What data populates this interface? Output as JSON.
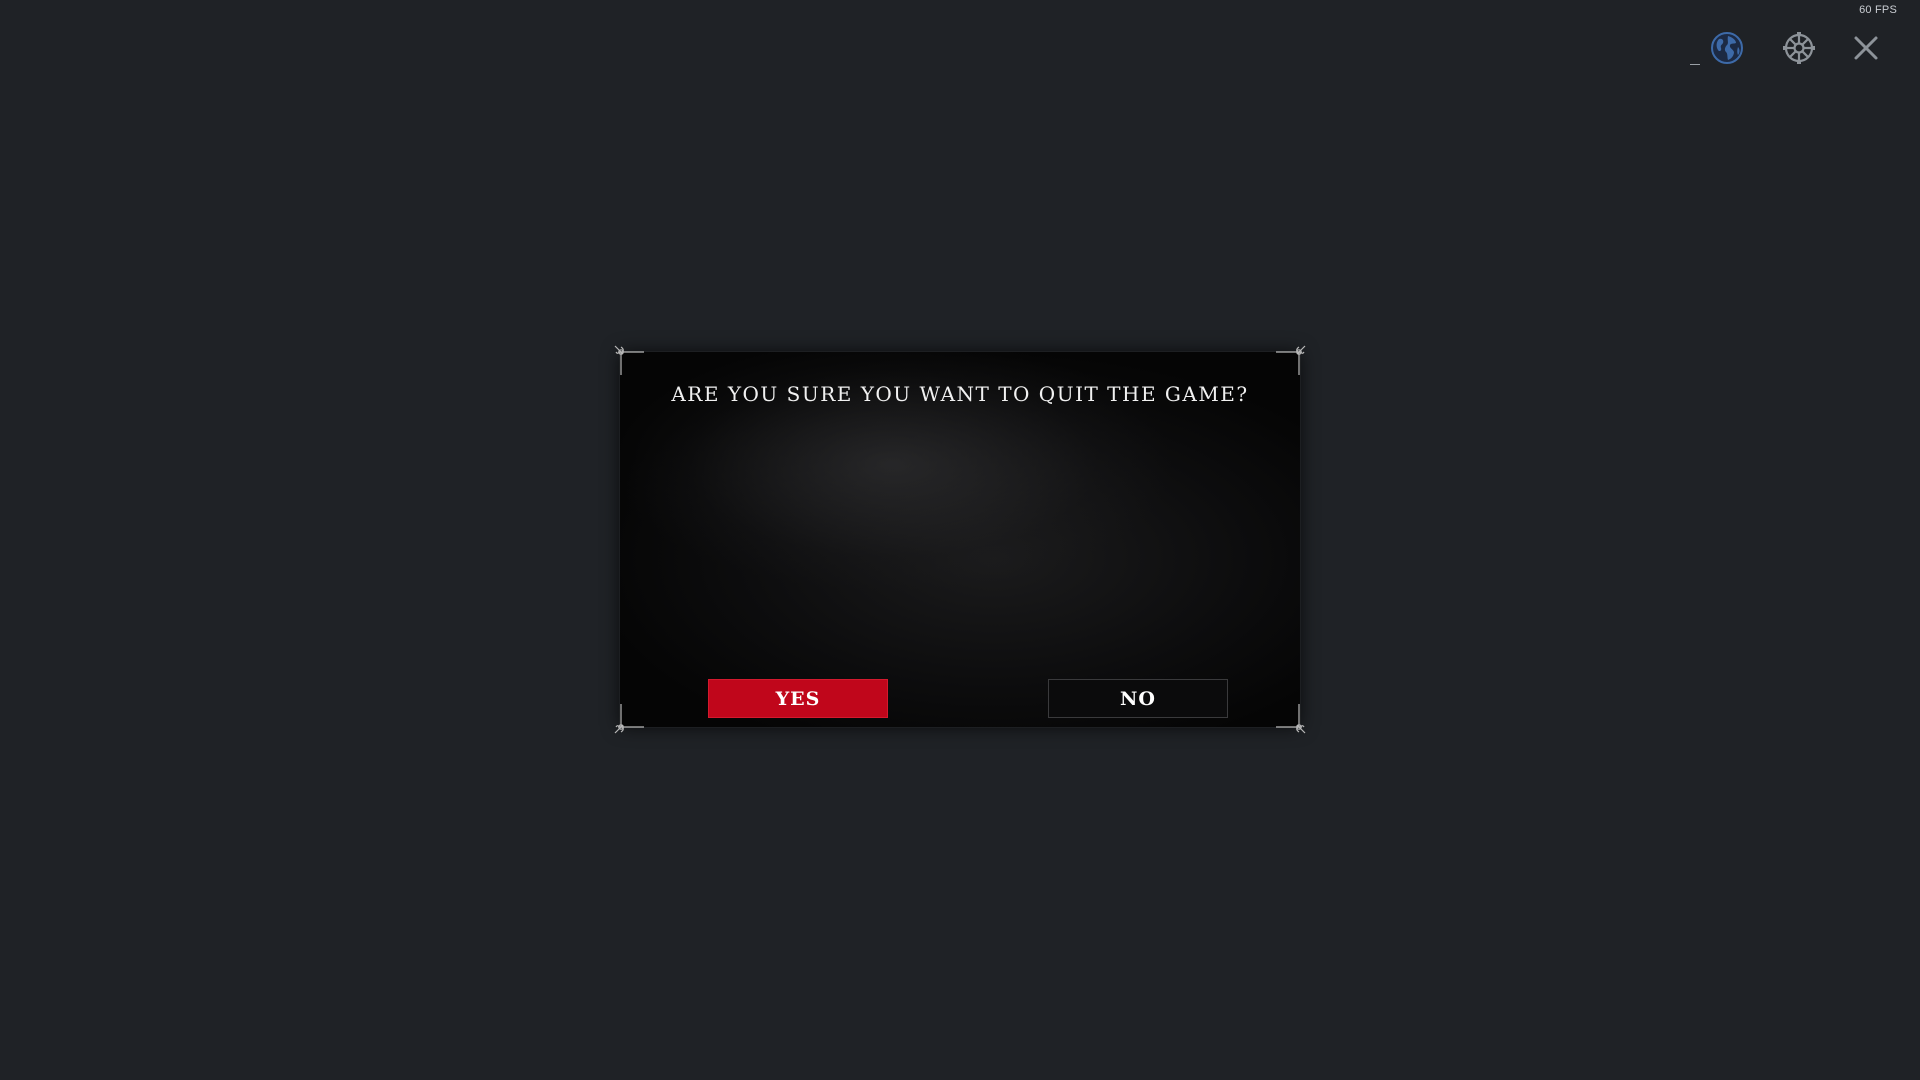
{
  "overlay": {
    "fps_label": "60 FPS"
  },
  "window_controls": {
    "minimize_icon": "minimize-icon",
    "language_icon": "globe-icon",
    "settings_icon": "gear-icon",
    "close_icon": "close-icon"
  },
  "quit_dialog": {
    "title": "ARE YOU SURE YOU WANT TO QUIT THE GAME?",
    "yes_label": "YES",
    "no_label": "NO"
  },
  "colors": {
    "background": "#1f2226",
    "yes_button": "#c0061b",
    "no_button": "#0b0b0c",
    "globe_accent": "#3d6aa8"
  }
}
